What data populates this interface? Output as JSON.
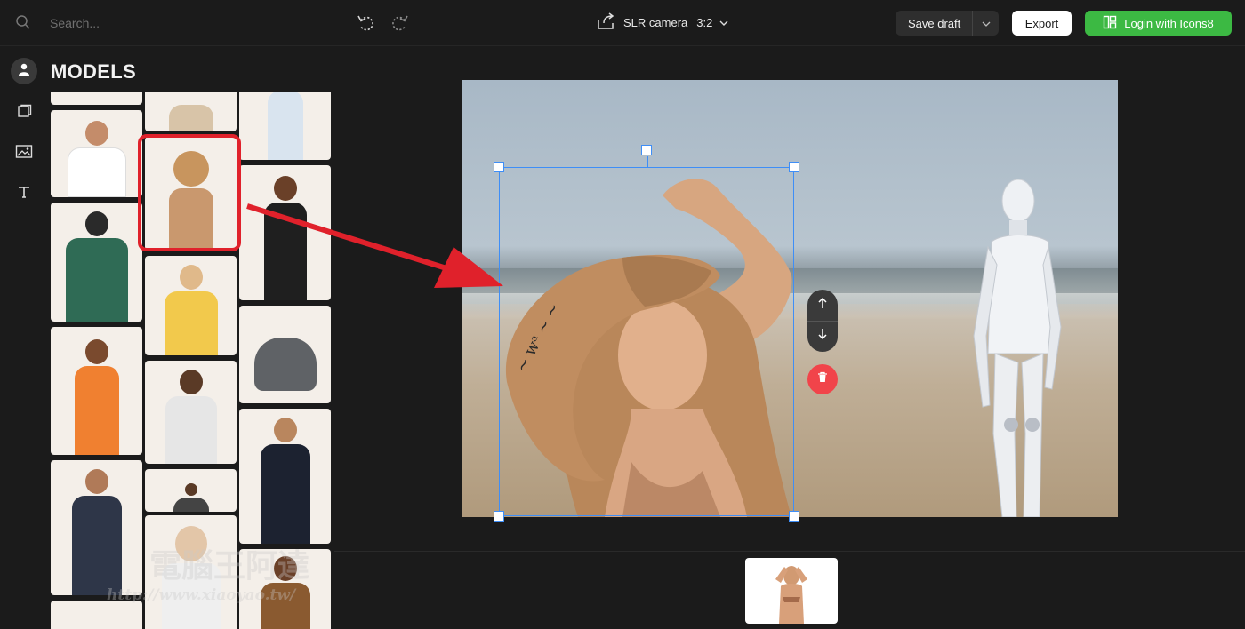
{
  "search": {
    "placeholder": "Search..."
  },
  "panel": {
    "title": "MODELS"
  },
  "rail": {
    "items": [
      {
        "name": "models",
        "icon": "user-icon",
        "active": true
      },
      {
        "name": "objects",
        "icon": "layers-icon",
        "active": false
      },
      {
        "name": "backgrounds",
        "icon": "image-icon",
        "active": false
      },
      {
        "name": "text",
        "icon": "text-icon",
        "active": false
      }
    ]
  },
  "toolbar": {
    "canvas_name": "SLR camera",
    "canvas_ratio": "3:2",
    "save_label": "Save draft",
    "export_label": "Export",
    "login_label": "Login with Icons8"
  },
  "watermark": {
    "text": "電腦王阿達",
    "url": "http://www.xiaoyao.tw/"
  },
  "colors": {
    "accent": "#3e8ef7",
    "login": "#3cb943",
    "delete": "#f1444a",
    "highlight": "#e0212b",
    "background": "#1b1b1b"
  }
}
